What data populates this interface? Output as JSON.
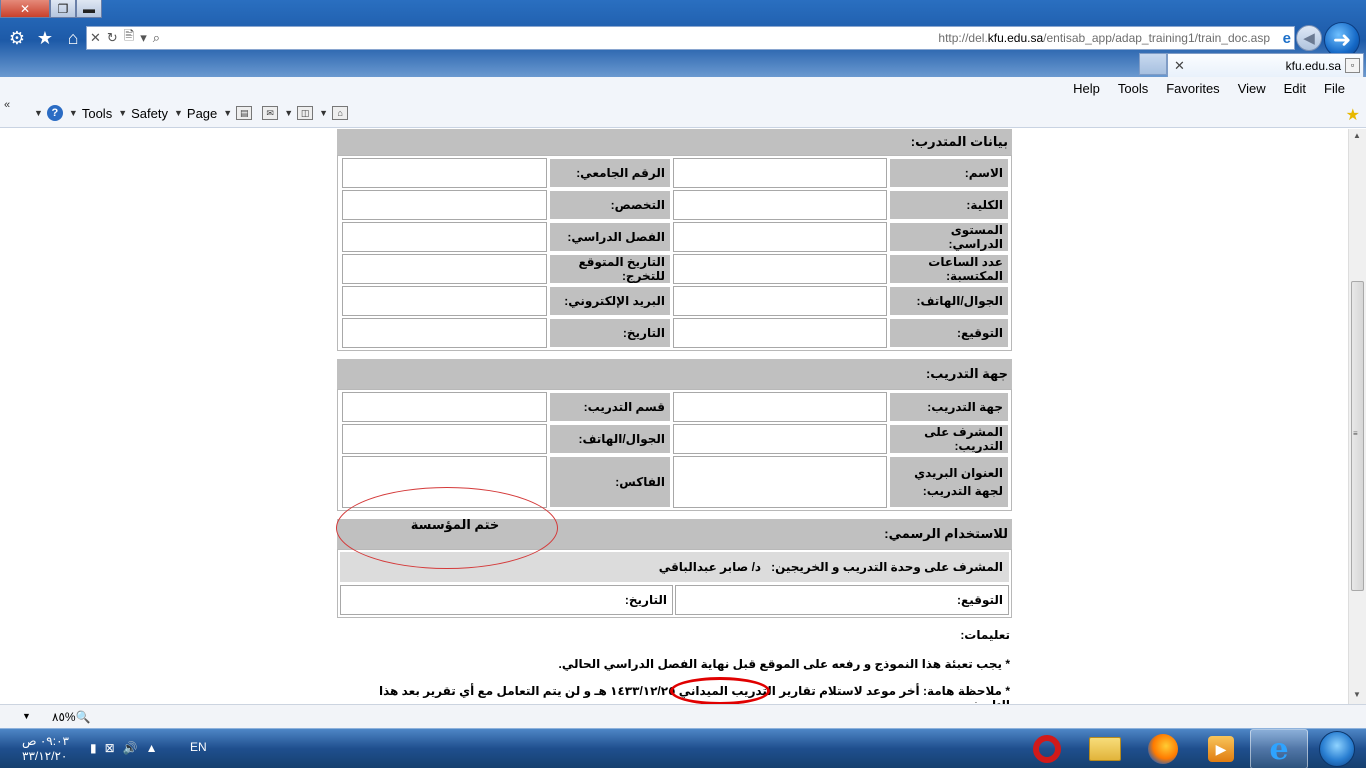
{
  "window": {
    "close_glyph": "✕",
    "restore_glyph": "❐",
    "minimize_glyph": "▬"
  },
  "toolbar_icons": [
    "gear-icon",
    "star-icon",
    "home-icon"
  ],
  "address_bar": {
    "controls": [
      "✕",
      "↻",
      "🖹",
      "▾",
      "⌕"
    ],
    "url_prefix": "http://del.",
    "url_domain": "kfu.edu.sa",
    "url_path": "/entisab_app/adap_training1/train_doc.asp"
  },
  "tab": {
    "title": "kfu.edu.sa",
    "close_glyph": "✕"
  },
  "menu": [
    "Help",
    "Tools",
    "Favorites",
    "View",
    "Edit",
    "File"
  ],
  "command_bar": {
    "chevron": "«",
    "tools_label": "Tools",
    "safety_label": "Safety",
    "page_label": "Page"
  },
  "form": {
    "trainee_header": "بيانات المتدرب:",
    "trainee_rows": [
      {
        "label_a": "الاسم:",
        "label_b": "الرقم الجامعي:"
      },
      {
        "label_a": "الكلية:",
        "label_b": "التخصص:"
      },
      {
        "label_a": "المستوى الدراسي:",
        "label_b": "الفصل الدراسي:"
      },
      {
        "label_a": "عدد الساعات المكتسبة:",
        "label_b": "التاريخ المتوقع للتخرج:"
      },
      {
        "label_a": "الجوال/الهاتف:",
        "label_b": "البريد الإلكتروني:"
      },
      {
        "label_a": "التوقيع:",
        "label_b": "التاريخ:"
      }
    ],
    "training_header": "جهة التدريب:",
    "training_rows": [
      {
        "label_a": "جهة التدريب:",
        "label_b": "قسم التدريب:"
      },
      {
        "label_a": "المشرف على التدريب:",
        "label_b": "الجوال/الهاتف:"
      },
      {
        "label_a": "العنوان البريدي لجهة التدريب:",
        "label_b": "الفاكس:"
      }
    ],
    "official_header": "للاستخدام الرسمي:",
    "stamp_label": "ختم المؤسسة",
    "supervisor_label": "المشرف على وحدة التدريب و الخريجين:",
    "supervisor_name": "د/ صابر عبدالباقي",
    "signature_label": "التوقيع:",
    "date_label": "التاريخ:",
    "instructions_header": "تعليمات:",
    "note_1": "* يجب تعبئة هذا النموذج و رفعه على الموقع قبل نهاية الفصل الدراسي الحالي.",
    "note_2_before": "* ملاحظة هامة: أخر موعد لاستلام تقارير التدريب الميداني",
    "note_2_date": "١٤٣٣/١٢/٢٥ هـ",
    "note_2_after": "و لن يتم التعامل مع أي تقرير بعد هذا التاريخ."
  },
  "status_bar": {
    "zoom": "٨٥%"
  },
  "taskbar": {
    "time": "٠٩:٠٣ ص",
    "date": "٣٣/١٢/٢٠",
    "language": "EN",
    "apps": [
      "opera-icon",
      "explorer-folder-icon",
      "firefox-icon",
      "media-player-icon",
      "internet-explorer-icon",
      "start-orb-icon"
    ]
  },
  "colors": {
    "label_bg": "#c0c0c0",
    "highlight_red": "#e00000",
    "taskbar_blue": "#1f4f8e"
  }
}
